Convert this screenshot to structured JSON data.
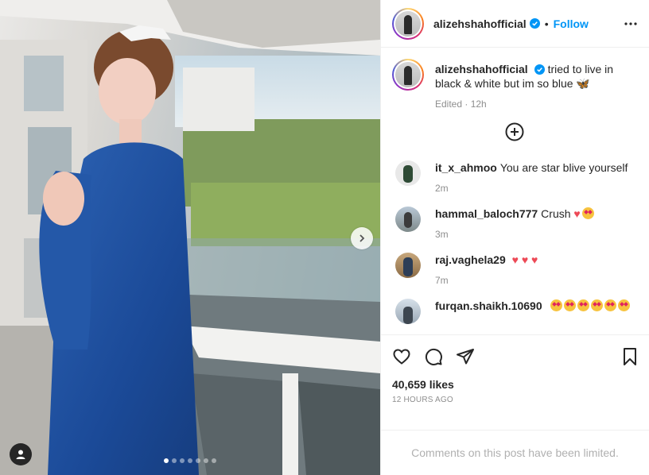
{
  "post": {
    "username": "alizehshahofficial",
    "follow_label": "Follow",
    "separator": "•",
    "caption_text": "tried to live in black & white but im so blue 🦋",
    "caption_meta": "Edited · 12h",
    "likes": "40,659 likes",
    "posted_ago": "12 HOURS AGO",
    "comments_limited": "Comments on this post have been limited.",
    "carousel": {
      "count": 7,
      "active_index": 0
    }
  },
  "comments": [
    {
      "user": "it_x_ahmoo",
      "text": "You are star blive yourself",
      "ago": "2m"
    },
    {
      "user": "hammal_baloch777",
      "text": "Crush",
      "ago": "3m"
    },
    {
      "user": "raj.vaghela29",
      "text": "",
      "ago": "7m"
    },
    {
      "user": "furqan.shaikh.10690",
      "text": "",
      "ago": ""
    }
  ],
  "colors": {
    "accent": "#0095f6",
    "heart": "#ed4956",
    "dress": "#1f4d9a"
  },
  "icons": [
    "more-icon",
    "verified-icon",
    "plus-circle-icon",
    "like-icon",
    "comment-icon",
    "share-icon",
    "save-icon",
    "next-icon",
    "tag-user-icon"
  ]
}
